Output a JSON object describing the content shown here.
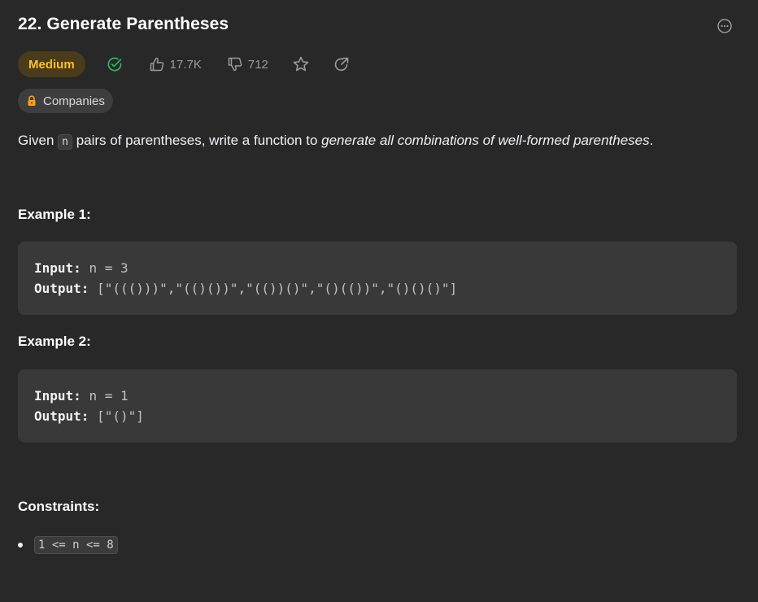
{
  "problem": {
    "title": "22. Generate Parentheses",
    "difficulty": "Medium",
    "likes": "17.7K",
    "dislikes": "712",
    "companies_label": "Companies"
  },
  "description": {
    "prefix": "Given ",
    "var_n": "n",
    "middle": " pairs of parentheses, write a function to ",
    "emphasis": "generate all combinations of well-formed parentheses",
    "suffix": "."
  },
  "examples": [
    {
      "heading": "Example 1:",
      "input_label": "Input:",
      "input_value": "n = 3",
      "output_label": "Output:",
      "output_value": "[\"((()))\",\"(()())\",\"(())()\",\"()(())\",\"()()()\"]"
    },
    {
      "heading": "Example 2:",
      "input_label": "Input:",
      "input_value": "n = 1",
      "output_label": "Output:",
      "output_value": "[\"()\"]"
    }
  ],
  "constraints": {
    "heading": "Constraints:",
    "items": [
      "1 <= n <= 8"
    ]
  },
  "icons": {
    "solved": "check-circle-icon",
    "like": "thumbs-up-icon",
    "dislike": "thumbs-down-icon",
    "favorite": "star-icon",
    "share": "share-icon",
    "lock": "lock-icon",
    "more": "more-options-icon"
  },
  "colors": {
    "background": "#282828",
    "difficulty_medium": "#ffc01e",
    "solved_green": "#2cbb5d",
    "lock_orange": "#ffa116"
  }
}
